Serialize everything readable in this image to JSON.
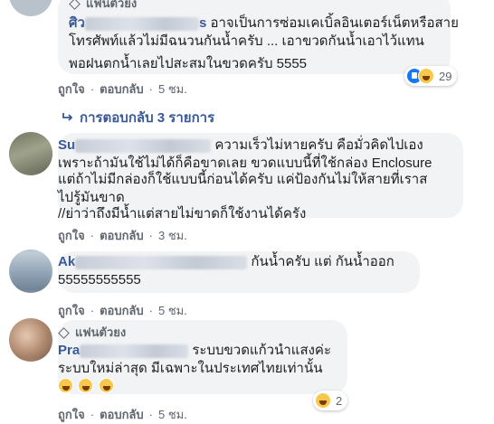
{
  "comment1": {
    "badge": "แฟนตัวยง",
    "name_visible": "ศิว",
    "name_tail": "s",
    "text_line1": "อาจเป็นการซ่อมเคเบิ้ลอินเตอร์เน็ตหรือสาย",
    "text_line2": "โทรศัพท์แล้วไม่มีฉนวนกันน้ำครับ ... เอาขวดกันน้ำเอาไว้แทน",
    "text_line3": "พอฝนตกน้ำเลยไปสะสมในขวดครับ 5555",
    "reaction_count": "29",
    "actions": {
      "like": "ถูกใจ",
      "reply": "ตอบกลับ",
      "time": "5 ชม."
    }
  },
  "replies_toggle": {
    "label": "การตอบกลับ 3 รายการ",
    "icon": "reply-arrow-icon"
  },
  "comment2": {
    "name_visible": "Su",
    "text_line1": "ความเร็วไม่หายครับ คือมั่วคิดไปเอง",
    "text_line2": "เพราะถ้ามันใช้ไม่ได้ก็คือขาดเลย ขวดแบบนี้ที่ใช้กล่อง Enclosure",
    "text_line3": "แต่ถ้าไม่มีกล่องก็ใช้แบบนี้ก่อนได้ครับ แค่ป้องกันไม่ให้สายที่เราส",
    "text_line4": "ไปรู้มันขาด",
    "text_line5": "//ย่าว่าถึงมีน้ำแต่สายไม่ขาดก็ใช้งานได้ครัง",
    "actions": {
      "like": "ถูกใจ",
      "reply": "ตอบกลับ",
      "time": "3 ชม."
    }
  },
  "comment3": {
    "name_visible": "Ak",
    "text_line1": "กันน้ำครับ แต่ กันน้ำออก",
    "text_line2": "55555555555",
    "actions": {
      "like": "ถูกใจ",
      "reply": "ตอบกลับ",
      "time": "5 ชม."
    }
  },
  "comment4": {
    "badge": "แฟนตัวยง",
    "name_visible": "Pra",
    "text_line1": "ระบบขวดแก้วนำแสงค่ะ",
    "text_line2": "ระบบใหม่ล่าสุด มีเฉพาะในประเทศไทยเท่านั้น",
    "reaction_count": "2",
    "actions": {
      "like": "ถูกใจ",
      "reply": "ตอบกลับ",
      "time": "5 ชม."
    }
  },
  "colors": {
    "link": "#385898",
    "bubble": "#f2f3f5",
    "meta": "#606770"
  }
}
